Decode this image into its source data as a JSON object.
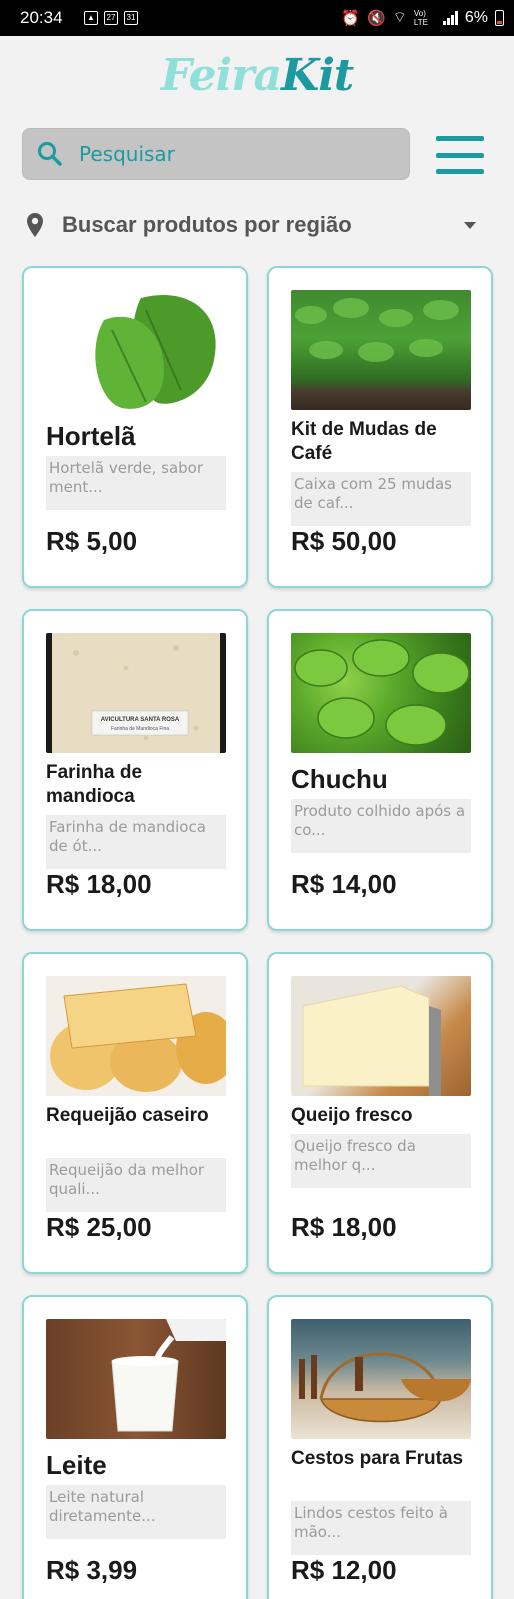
{
  "status_bar": {
    "time": "20:34",
    "calendar_day": "27",
    "date_day": "31",
    "battery": "6%",
    "network": "Vo) LTE"
  },
  "logo": {
    "part1": "Feira",
    "part2": "Kit"
  },
  "search": {
    "placeholder": "Pesquisar"
  },
  "region": {
    "label": "Buscar produtos por região"
  },
  "products": [
    {
      "name": "Hortelã",
      "description": "Hortelã verde, sabor ment...",
      "price": "R$ 5,00",
      "image_icon": "mint-leaves-image"
    },
    {
      "name": "Kit de Mudas de Café",
      "description": "Caixa com 25 mudas de caf...",
      "price": "R$ 50,00",
      "image_icon": "coffee-seedlings-image"
    },
    {
      "name": "Farinha de mandioca",
      "description": "Farinha de mandioca de ót...",
      "price": "R$ 18,00",
      "image_icon": "flour-bag-image",
      "image_caption": "AVICULTURA SANTA ROSA",
      "image_caption_sub": "Farinha de Mandioca Fina"
    },
    {
      "name": "Chuchu",
      "description": "Produto colhido após a co...",
      "price": "R$ 14,00",
      "image_icon": "chayote-image"
    },
    {
      "name": "Requeijão caseiro",
      "description": "Requeijão da melhor quali...",
      "price": "R$ 25,00",
      "image_icon": "requeijao-image"
    },
    {
      "name": "Queijo fresco",
      "description": "Queijo fresco da melhor q...",
      "price": "R$ 18,00",
      "image_icon": "cheese-image"
    },
    {
      "name": "Leite",
      "description": "Leite natural diretamente...",
      "price": "R$ 3,99",
      "image_icon": "milk-glass-image"
    },
    {
      "name": "Cestos para Frutas",
      "description": "Lindos cestos feito à mão...",
      "price": "R$ 12,00",
      "image_icon": "baskets-image"
    }
  ],
  "colors": {
    "brand": "#1b9aa0",
    "brand_light": "#8fe0d8",
    "card_border": "#8cd7d4"
  }
}
